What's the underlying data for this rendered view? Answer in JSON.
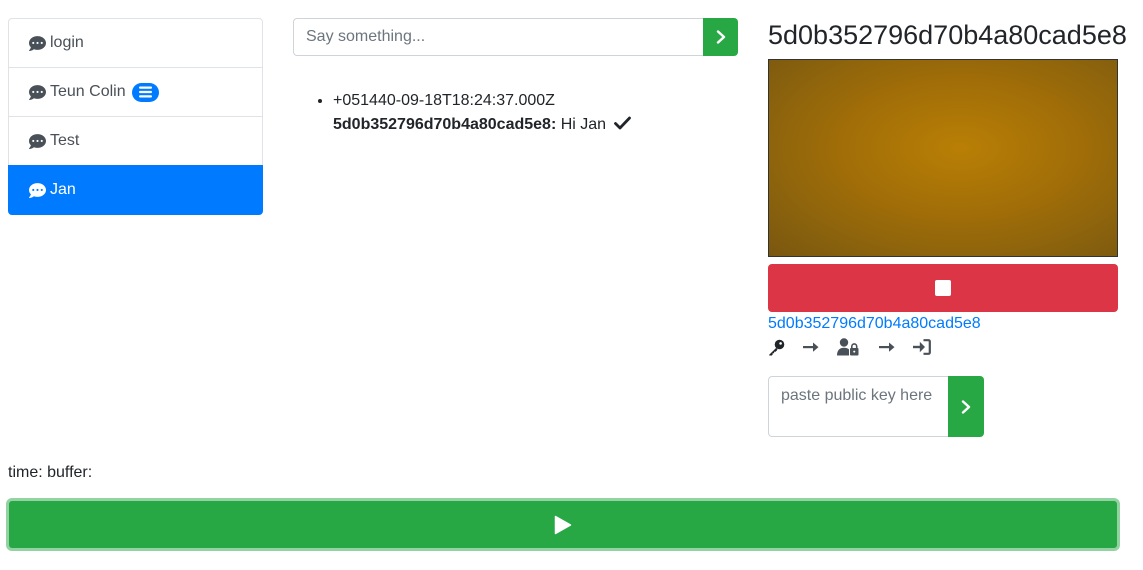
{
  "sidebar": {
    "items": [
      {
        "label": "login",
        "icon": "comment-dots-icon",
        "active": false
      },
      {
        "label": "Teun Colin",
        "icon": "comment-dots-icon",
        "active": false,
        "badge_icon": "list-icon"
      },
      {
        "label": "Test",
        "icon": "comment-dots-icon",
        "active": false
      },
      {
        "label": "Jan",
        "icon": "comment-dots-icon",
        "active": true
      }
    ]
  },
  "chat": {
    "input_placeholder": "Say something...",
    "send_icon": "chevron-right-icon",
    "messages": [
      {
        "timestamp": "+051440-09-18T18:24:37.000Z",
        "sender": "5d0b352796d70b4a80cad5e8:",
        "text": "Hi Jan",
        "status_icon": "check-icon"
      }
    ]
  },
  "room": {
    "title": "5d0b352796d70b4a80cad5e8",
    "stop_icon": "stop-icon",
    "peer_link": "5d0b352796d70b4a80cad5e8",
    "icons": [
      "key-icon",
      "arrow-right-icon",
      "user-lock-icon",
      "arrow-right-icon",
      "sign-in-icon"
    ],
    "key_input_placeholder": "paste public key here",
    "key_submit_icon": "chevron-right-icon"
  },
  "footer": {
    "status_text": "time: buffer:",
    "play_icon": "play-icon"
  },
  "colors": {
    "primary": "#007bff",
    "success": "#28a745",
    "danger": "#dc3545",
    "border": "#ced4da"
  }
}
